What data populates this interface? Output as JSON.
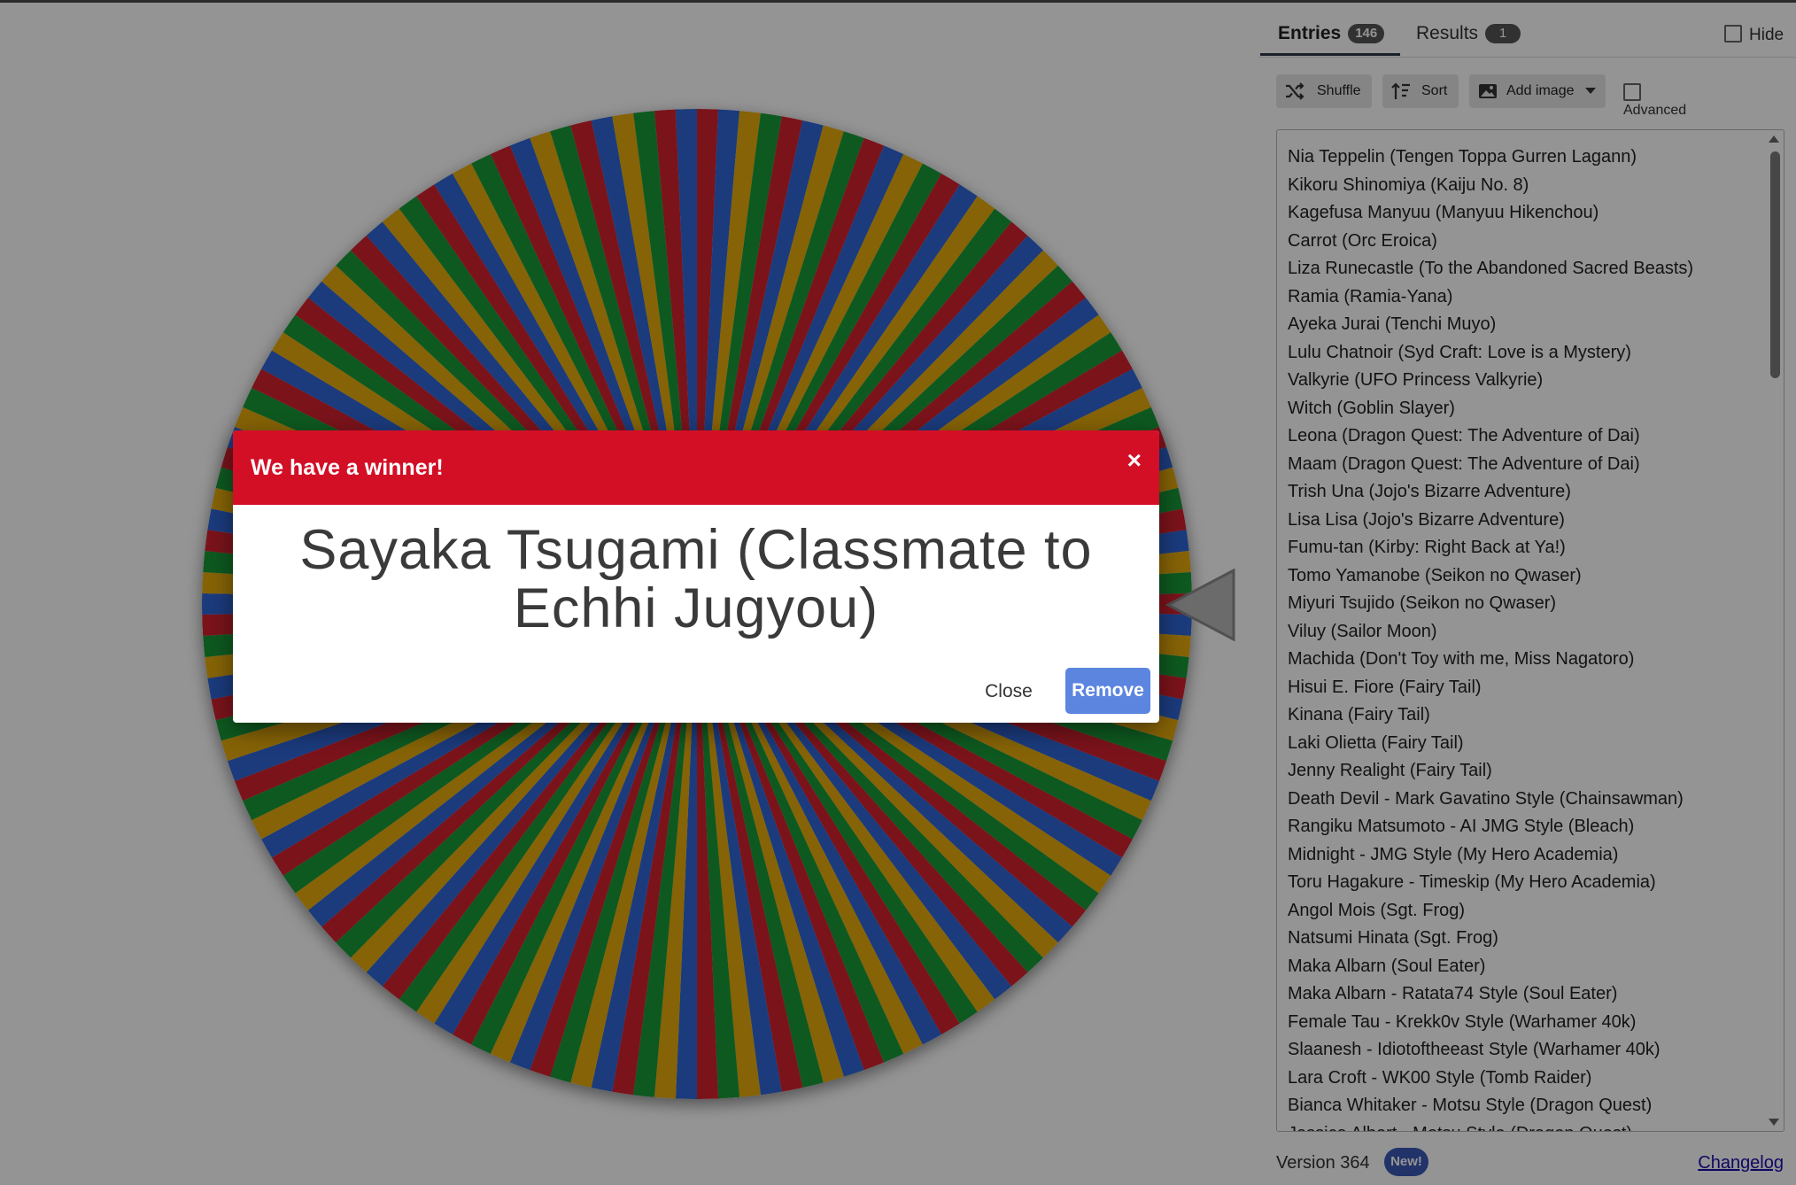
{
  "tabs": {
    "entries_label": "Entries",
    "entries_count": "146",
    "results_label": "Results",
    "results_count": "1",
    "hide_label": "Hide"
  },
  "toolbar": {
    "shuffle_label": "Shuffle",
    "sort_label": "Sort",
    "add_image_label": "Add image",
    "advanced_label": "Advanced"
  },
  "entries": [
    "Nia Teppelin (Tengen Toppa Gurren Lagann)",
    "Kikoru Shinomiya (Kaiju No. 8)",
    "Kagefusa Manyuu (Manyuu Hikenchou)",
    "Carrot (Orc Eroica)",
    "Liza Runecastle (To the Abandoned Sacred Beasts)",
    "Ramia (Ramia-Yana)",
    "Ayeka Jurai (Tenchi Muyo)",
    "Lulu Chatnoir (Syd Craft: Love is a Mystery)",
    "Valkyrie (UFO Princess Valkyrie)",
    "Witch (Goblin Slayer)",
    "Leona (Dragon Quest: The Adventure of Dai)",
    "Maam (Dragon Quest: The Adventure of Dai)",
    "Trish Una (Jojo's Bizarre Adventure)",
    "Lisa Lisa (Jojo's Bizarre Adventure)",
    "Fumu-tan (Kirby: Right Back at Ya!)",
    "Tomo Yamanobe (Seikon no Qwaser)",
    "Miyuri Tsujido (Seikon no Qwaser)",
    "Viluy (Sailor Moon)",
    "Machida (Don't Toy with me, Miss Nagatoro)",
    "Hisui E. Fiore (Fairy Tail)",
    "Kinana (Fairy Tail)",
    "Laki Olietta (Fairy Tail)",
    "Jenny Realight (Fairy Tail)",
    "Death Devil - Mark Gavatino Style (Chainsawman)",
    "Rangiku Matsumoto - AI JMG Style (Bleach)",
    "Midnight - JMG Style (My Hero Academia)",
    "Toru Hagakure - Timeskip (My Hero Academia)",
    "Angol Mois (Sgt. Frog)",
    "Natsumi Hinata (Sgt. Frog)",
    "Maka Albarn (Soul Eater)",
    "Maka Albarn - Ratata74 Style (Soul Eater)",
    "Female Tau - Krekk0v Style (Warhamer 40k)",
    "Slaanesh - Idiotoftheeast Style (Warhamer 40k)",
    "Lara Croft - WK00 Style (Tomb Raider)",
    "Bianca Whitaker - Motsu Style (Dragon Quest)",
    "Jessica Albert - Motsu Style (Dragon Quest)"
  ],
  "footer": {
    "version": "Version 364",
    "new_badge": "New!",
    "changelog": "Changelog"
  },
  "modal": {
    "title": "We have a winner!",
    "close_x": "×",
    "winner": "Sayaka Tsugami (Classmate to Echhi Jugyou)",
    "close_label": "Close",
    "remove_label": "Remove"
  },
  "wheel": {
    "segment_count": 146,
    "segment_colors": [
      "#d5212f",
      "#2f67d8",
      "#e7ab0b",
      "#199a38"
    ]
  },
  "icons": {
    "shuffle": "shuffle-icon",
    "sort": "sort-icon",
    "image": "image-icon",
    "dropdown": "chevron-down-icon",
    "pointer": "pointer-triangle-icon"
  }
}
